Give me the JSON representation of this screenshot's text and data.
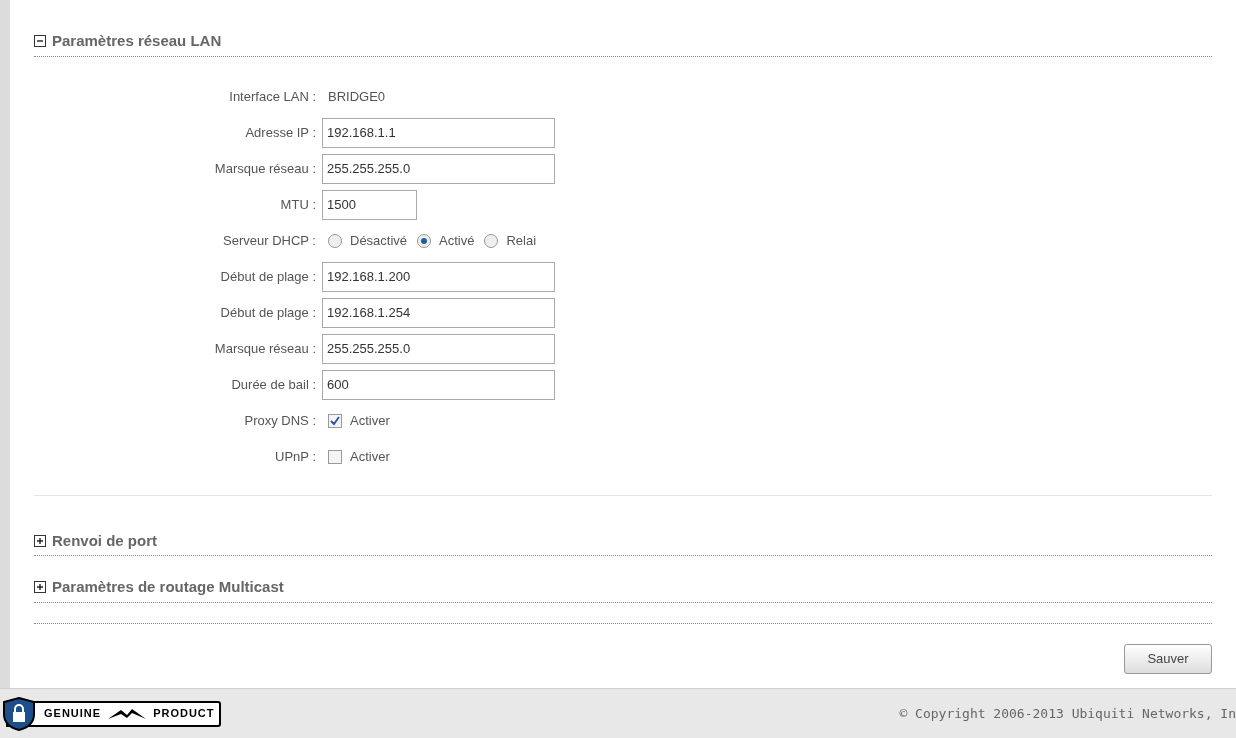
{
  "sections": [
    {
      "title": "Paramètres réseau LAN",
      "expanded": true,
      "rows": [
        {
          "kind": "text",
          "label": "Interface LAN :",
          "value": "BRIDGE0"
        },
        {
          "kind": "input",
          "label": "Adresse IP :",
          "value": "192.168.1.1"
        },
        {
          "kind": "input",
          "label": "Marsque réseau :",
          "value": "255.255.255.0"
        },
        {
          "kind": "short_input",
          "label": "MTU :",
          "value": "1500"
        },
        {
          "kind": "radio",
          "label": "Serveur DHCP :",
          "options": [
            {
              "label": "Désactivé",
              "selected": false
            },
            {
              "label": "Activé",
              "selected": true
            },
            {
              "label": "Relai",
              "selected": false
            }
          ]
        },
        {
          "kind": "input",
          "label": "Début de plage :",
          "value": "192.168.1.200"
        },
        {
          "kind": "input",
          "label": "Début de plage :",
          "value": "192.168.1.254"
        },
        {
          "kind": "input",
          "label": "Marsque réseau :",
          "value": "255.255.255.0"
        },
        {
          "kind": "input",
          "label": "Durée de bail :",
          "value": "600"
        },
        {
          "kind": "checkbox",
          "label": "Proxy DNS :",
          "option": "Activer",
          "checked": true
        },
        {
          "kind": "checkbox",
          "label": "UPnP :",
          "option": "Activer",
          "checked": false
        }
      ]
    },
    {
      "title": "Renvoi de port",
      "expanded": false
    },
    {
      "title": "Paramètres de routage Multicast",
      "expanded": false
    }
  ],
  "save_button": "Sauver",
  "footer": {
    "badge": [
      "GENUINE",
      "PRODUCT"
    ],
    "copyright": "© Copyright 2006-2013 Ubiquiti Networks, In"
  }
}
